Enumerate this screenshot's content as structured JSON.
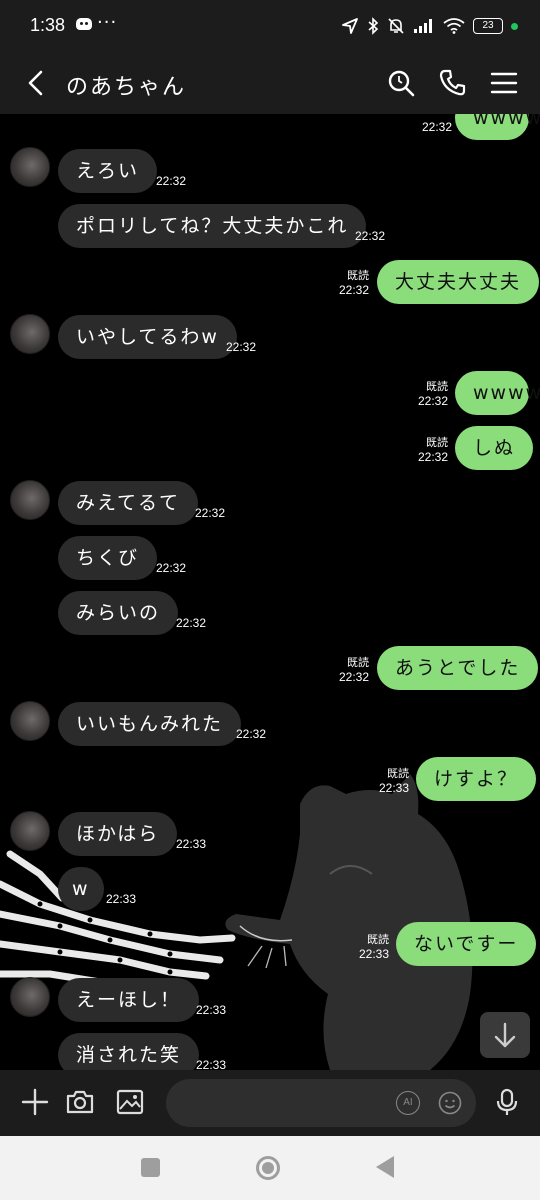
{
  "status_bar": {
    "time": "1:38",
    "more": "···",
    "battery": "23",
    "icons": [
      "discord-icon",
      "location-icon",
      "bluetooth-icon",
      "mute-icon",
      "signal-icon",
      "wifi-icon",
      "battery-icon"
    ]
  },
  "header": {
    "title": "のあちゃん",
    "icons": [
      "back-icon",
      "search-icon",
      "phone-icon",
      "menu-icon"
    ]
  },
  "messages": [
    {
      "side": "right",
      "text": "wwww",
      "time": "22:32",
      "read": ""
    },
    {
      "side": "left",
      "text": "えろい",
      "time": "22:32",
      "avatar": true
    },
    {
      "side": "left",
      "text": "ポロリしてね？大丈夫かこれ",
      "time": "22:32",
      "avatar": false
    },
    {
      "side": "right",
      "text": "大丈夫大丈夫",
      "time": "22:32",
      "read": "既読"
    },
    {
      "side": "left",
      "text": "いやしてるわw",
      "time": "22:32",
      "avatar": true
    },
    {
      "side": "right",
      "text": "wwww",
      "time": "22:32",
      "read": "既読"
    },
    {
      "side": "right",
      "text": "しぬ",
      "time": "22:32",
      "read": "既読"
    },
    {
      "side": "left",
      "text": "みえてるて",
      "time": "22:32",
      "avatar": true
    },
    {
      "side": "left",
      "text": "ちくび",
      "time": "22:32",
      "avatar": false
    },
    {
      "side": "left",
      "text": "みらいの",
      "time": "22:32",
      "avatar": false
    },
    {
      "side": "right",
      "text": "あうとでした",
      "time": "22:32",
      "read": "既読"
    },
    {
      "side": "left",
      "text": "いいもんみれた",
      "time": "22:32",
      "avatar": true
    },
    {
      "side": "right",
      "text": "けすよ？",
      "time": "22:33",
      "read": "既読"
    },
    {
      "side": "left",
      "text": "ほかはら",
      "time": "22:33",
      "avatar": true
    },
    {
      "side": "left",
      "text": "w",
      "time": "22:33",
      "avatar": false
    },
    {
      "side": "right",
      "text": "ないですー",
      "time": "22:33",
      "read": "既読"
    },
    {
      "side": "left",
      "text": "えーほし！",
      "time": "22:33",
      "avatar": true
    },
    {
      "side": "left",
      "text": "消された笑",
      "time": "22:33",
      "avatar": false
    }
  ],
  "input_bar": {
    "ai_label": "AI",
    "icons": [
      "plus-icon",
      "camera-icon",
      "image-icon",
      "ai-icon",
      "emoji-icon",
      "mic-icon"
    ]
  },
  "nav_bar": {
    "icons": [
      "recents-icon",
      "home-icon",
      "back-nav-icon"
    ]
  }
}
